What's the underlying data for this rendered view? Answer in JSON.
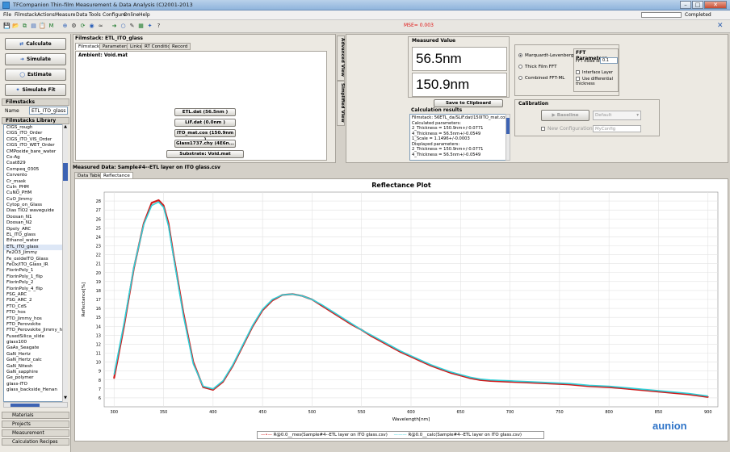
{
  "window": {
    "title": "TFCompanion Thin-film Measurement & Data Analysis (C)2001-2013",
    "progress_status": "Completed",
    "mse_text": "MSE= 0.003"
  },
  "menu": [
    "File",
    "Filmstack",
    "Actions",
    "Measure",
    "Data",
    "Tools",
    "Configure",
    "Online",
    "Help"
  ],
  "toolbar_icons": [
    "save-icon",
    "open-icon",
    "copy-icon",
    "chart-icon",
    "paste-icon",
    "measure-icon",
    "zoom-icon",
    "settings-icon",
    "refresh-icon",
    "camera-icon",
    "wave-icon",
    "forward-icon",
    "circle-icon",
    "pen-icon",
    "layers-icon",
    "fit-icon",
    "help-icon"
  ],
  "left": {
    "buttons": [
      "Calculate",
      "Simulate",
      "Estimate",
      "Simulate Fit"
    ],
    "filmstacks_header": "Filmstacks",
    "name_label": "Name",
    "name_value": "ETL_ITO_glass",
    "library_header": "Filmstacks Library",
    "library": [
      "CIGS_rough",
      "CIGS_ITO_Order",
      "CIGS_ITO_VIS_Order",
      "CIGS_ITO_WET_Order",
      "CMPoxide_bare_water",
      "Co-Ag",
      "Coat829",
      "Compeq_0305",
      "Corvento",
      "Cr_mask",
      "CuIn_PHM",
      "CuNO_PHM",
      "CuO_Jimmy",
      "Cytop_on_Glass",
      "Dias TiO2 waveguide",
      "Doosan_N1",
      "Doosan_N2",
      "Dpoly_ARC",
      "EL_ITO_glass",
      "Ethanol_water",
      "ETL_ITO_glass",
      "Fe2O3_Jimmy",
      "Fe_oxideITO_Glass",
      "FeOx/ITO_Glass_IR",
      "FlorinPoly_1",
      "FlorinPoly_1_flip",
      "FlorinPoly_2",
      "FlorinPoly_4_flip",
      "FSG_ARC",
      "FSG_ARC_2",
      "FTO_CdS",
      "FTO_hos",
      "FTO_Jimmy_hos",
      "FTO_Perovskite",
      "FTO_Perovskite_Jimmy_hos",
      "FusedSilica_slide",
      "glass100",
      "GaAs_Seagate",
      "GaN_Hertz",
      "GaN_Hertz_calc",
      "GaN_Nitesh",
      "GaN_sapphire",
      "Ge_polymer",
      "glass-ITO",
      "glass_backside_Henan"
    ],
    "selected_index": 20,
    "bottom_tabs": [
      "Materials",
      "Projects",
      "Measurement",
      "Calculation Recipes"
    ]
  },
  "filmstack": {
    "title": "Filmstack: ETL_ITO_glass",
    "tabs": [
      "Filmstack",
      "Parameters",
      "Links",
      "RT Conditions",
      "Record"
    ],
    "ambient": "Ambient: Void.mat",
    "layers": [
      "ETL.dat (56.5nm )",
      "LiF.dat (0.0nm )",
      "ITO_mat.cos (150.9nm )",
      "Glass1737.chy (4E6n...",
      "Substrate: Void.mat"
    ],
    "side_tabs": [
      "Advanced View",
      "Simplified View"
    ]
  },
  "measured": {
    "header": "Measured Value",
    "value1": "56.5nm",
    "value2": "150.9nm",
    "save_button": "Save to Clipboard",
    "results_header": "Calculation results",
    "results_lines": [
      "Filmstack: 56ETL_da/SLiF.dat/150ITO_mat.cos/Glass1737...",
      "Calculated parameters:",
      "2_Thickness = 150.9nm+/-0.0771",
      "4_Thickness = 56.5nm+/-0.0549",
      "1_Scale = 1.1496+/-0.0003",
      "Displayed parameters:",
      "2_Thickness = 150.9nm+/-0.0771",
      "4_Thickness = 56.5nm+/-0.0549"
    ]
  },
  "fit": {
    "methods": [
      "Marquardt-Levenberg",
      "Thick Film FFT",
      "Combined FFT-ML"
    ],
    "selected_method": 0,
    "fft_header": "FFT Parameters",
    "fft_noise_label": "FFT noise level:",
    "fft_noise_value": "0.1",
    "interface_label": "Interface Layer",
    "differential_label": "Use differential thickness"
  },
  "calibration": {
    "header": "Calibration",
    "baseline_button": "Baseline",
    "default_option": "Default",
    "new_config_label": "New Configuration",
    "config_placeholder": "MyConfig"
  },
  "data_panel": {
    "header": "Measured Data: Sample#4--ETL layer on ITO glass.csv",
    "tabs": [
      "Data Table",
      "Reflectance"
    ]
  },
  "chart_data": {
    "type": "line",
    "title": "Reflectance Plot",
    "xlabel": "Wavelength[nm]",
    "ylabel": "Reflectance[%]",
    "xlim": [
      290,
      910
    ],
    "ylim": [
      5,
      29
    ],
    "xticks": [
      300,
      350,
      400,
      450,
      500,
      550,
      600,
      650,
      700,
      750,
      800,
      850,
      900
    ],
    "yticks": [
      6,
      7,
      8,
      9,
      10,
      11,
      12,
      13,
      14,
      15,
      16,
      17,
      18,
      19,
      20,
      21,
      22,
      23,
      24,
      25,
      26,
      27,
      28
    ],
    "grid": true,
    "legend_position": "bottom",
    "series": [
      {
        "name": "R@0.0__mes(Sample#4--ETL layer on ITO glass.csv)",
        "color": "#d11a1a",
        "x": [
          300,
          310,
          320,
          330,
          338,
          345,
          350,
          355,
          360,
          370,
          380,
          390,
          400,
          410,
          420,
          430,
          440,
          450,
          460,
          470,
          480,
          490,
          500,
          510,
          520,
          530,
          540,
          550,
          560,
          570,
          580,
          590,
          600,
          610,
          620,
          630,
          640,
          650,
          660,
          670,
          680,
          700,
          720,
          740,
          760,
          780,
          800,
          820,
          840,
          860,
          880,
          900
        ],
        "values": [
          8.2,
          14.0,
          20.5,
          25.5,
          27.8,
          28.1,
          27.5,
          25.5,
          22.0,
          15.5,
          10.0,
          7.2,
          6.9,
          7.8,
          9.6,
          11.8,
          14.0,
          15.8,
          16.9,
          17.5,
          17.6,
          17.4,
          17.0,
          16.3,
          15.6,
          14.9,
          14.2,
          13.6,
          12.9,
          12.3,
          11.7,
          11.1,
          10.6,
          10.1,
          9.6,
          9.2,
          8.8,
          8.5,
          8.2,
          8.0,
          7.9,
          7.8,
          7.7,
          7.6,
          7.5,
          7.3,
          7.2,
          7.0,
          6.8,
          6.6,
          6.4,
          6.1
        ]
      },
      {
        "name": "R@0.0__calc(Sample#4--ETL layer on ITO glass.csv)",
        "color": "#2fd0d8",
        "x": [
          300,
          310,
          320,
          330,
          338,
          345,
          350,
          355,
          360,
          370,
          380,
          390,
          400,
          410,
          420,
          430,
          440,
          450,
          460,
          470,
          480,
          490,
          500,
          510,
          520,
          530,
          540,
          550,
          560,
          570,
          580,
          590,
          600,
          610,
          620,
          630,
          640,
          650,
          660,
          670,
          680,
          700,
          720,
          740,
          760,
          780,
          800,
          820,
          840,
          860,
          880,
          900
        ],
        "values": [
          8.6,
          14.3,
          20.6,
          25.4,
          27.5,
          27.9,
          27.3,
          25.2,
          21.8,
          15.2,
          9.8,
          7.3,
          7.0,
          7.9,
          9.7,
          11.9,
          14.1,
          15.9,
          17.0,
          17.5,
          17.6,
          17.4,
          17.0,
          16.4,
          15.7,
          15.0,
          14.3,
          13.6,
          13.0,
          12.4,
          11.8,
          11.2,
          10.7,
          10.2,
          9.7,
          9.3,
          8.9,
          8.6,
          8.3,
          8.1,
          8.0,
          7.9,
          7.8,
          7.7,
          7.6,
          7.4,
          7.3,
          7.1,
          6.9,
          6.7,
          6.5,
          6.2
        ]
      }
    ]
  },
  "watermark": "aunion"
}
